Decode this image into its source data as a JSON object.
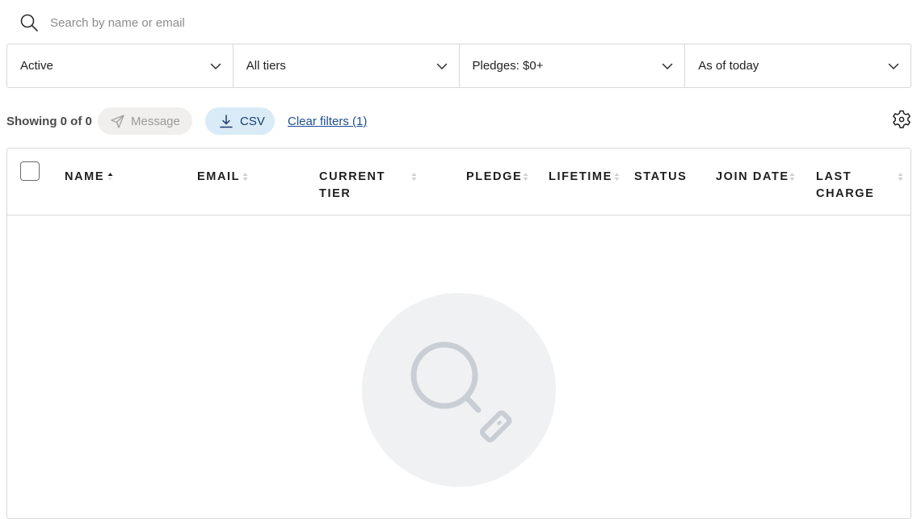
{
  "search": {
    "placeholder": "Search by name or email"
  },
  "filters": [
    {
      "label": "Active"
    },
    {
      "label": "All tiers"
    },
    {
      "label": "Pledges: $0+"
    },
    {
      "label": "As of today"
    }
  ],
  "actions": {
    "showing": "Showing 0 of 0",
    "message_label": "Message",
    "csv_label": "CSV",
    "clear_filters": "Clear filters (1)"
  },
  "table": {
    "columns": [
      {
        "label": "NAME",
        "sort": "ascending"
      },
      {
        "label": "EMAIL",
        "sort": "none"
      },
      {
        "label": "CURRENT TIER",
        "sort": "none"
      },
      {
        "label": "PLEDGE",
        "sort": "none"
      },
      {
        "label": "LIFETIME",
        "sort": "none"
      },
      {
        "label": "STATUS",
        "sort": "disabled"
      },
      {
        "label": "JOIN DATE",
        "sort": "none"
      },
      {
        "label": "LAST CHARGE",
        "sort": "none"
      }
    ],
    "rows": []
  },
  "colors": {
    "border": "#d9d9d9",
    "csv_bg": "#d9ebf7",
    "csv_text": "#1a3d66",
    "message_bg": "#f0efed",
    "link": "#1d4f91",
    "empty_circle": "#eff1f3",
    "empty_icon": "#c9ced4"
  },
  "icons": {
    "search": "search-icon",
    "chevron": "chevron-down-icon",
    "message": "send-icon",
    "csv": "download-icon",
    "settings": "gear-icon",
    "empty": "search-tag-icon"
  }
}
